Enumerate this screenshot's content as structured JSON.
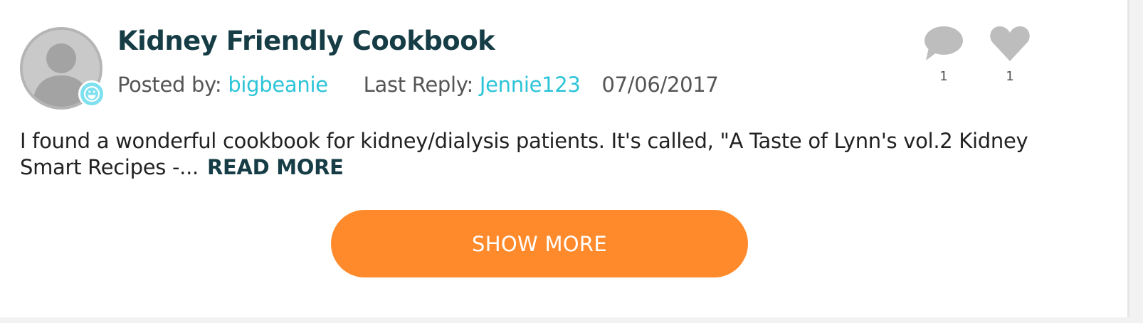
{
  "post": {
    "title": "Kidney Friendly Cookbook",
    "posted_by_label": "Posted by:",
    "author": "bigbeanie",
    "last_reply_label": "Last Reply:",
    "last_reply_user": "Jennie123",
    "date": "07/06/2017",
    "excerpt": "I found a wonderful cookbook for kidney/dialysis patients. It's called, \"A Taste of Lynn's vol.2 Kidney Smart Recipes -...",
    "read_more_label": "READ MORE",
    "comment_count": "1",
    "like_count": "1"
  },
  "icons": {
    "avatar": "default-user-avatar-icon",
    "badge": "smiley-face-icon",
    "comment": "speech-bubble-icon",
    "like": "heart-icon"
  },
  "show_more_label": "SHOW MORE",
  "colors": {
    "title": "#163d46",
    "link": "#2cc4d8",
    "button": "#ff8a2b",
    "icon_gray": "#bdbdbd"
  }
}
